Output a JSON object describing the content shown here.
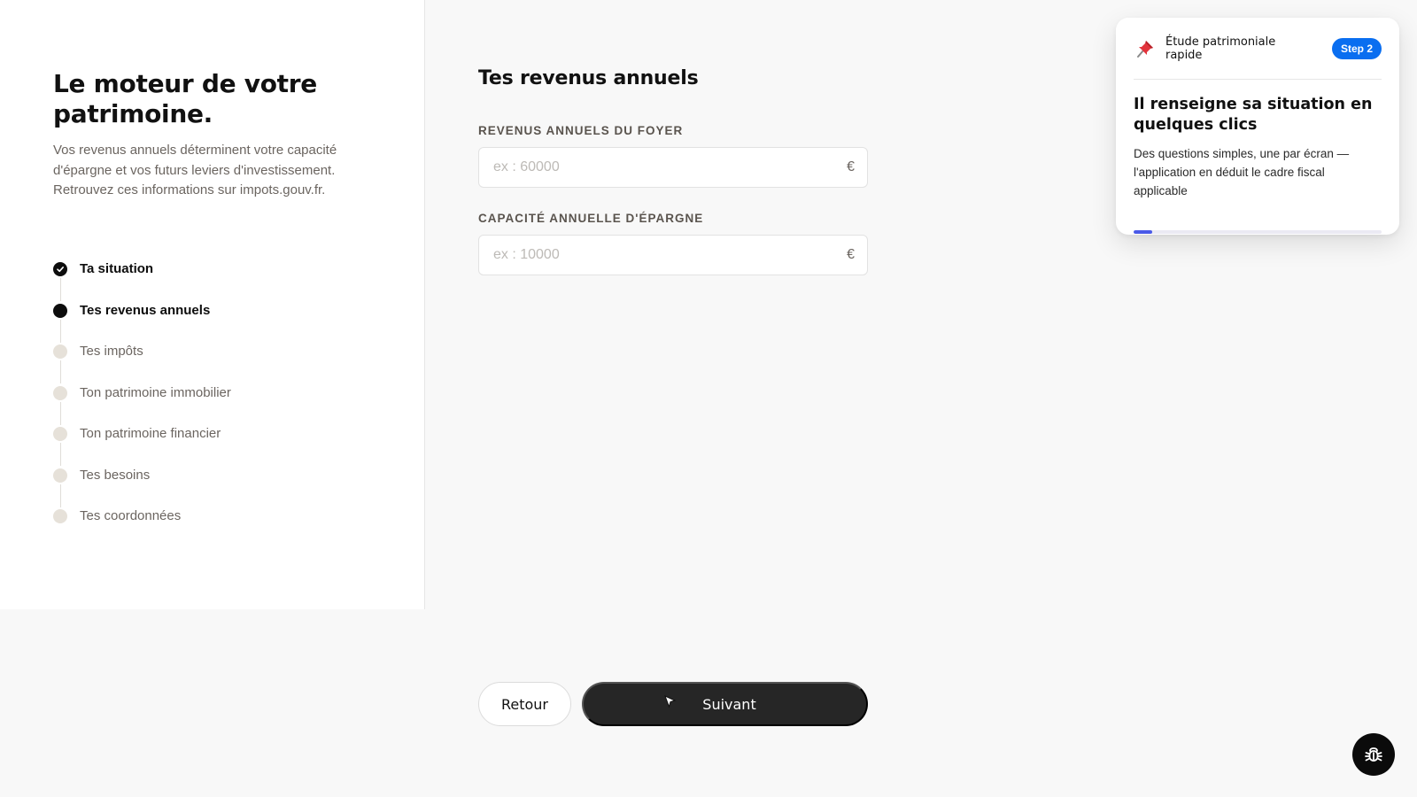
{
  "left": {
    "title": "Le moteur de votre patrimoine.",
    "description": "Vos revenus annuels déterminent votre capacité d'épargne et vos futurs leviers d'investissement. Retrouvez ces informations sur impots.gouv.fr.",
    "steps": [
      {
        "label": "Ta situation",
        "state": "done"
      },
      {
        "label": "Tes revenus annuels",
        "state": "active"
      },
      {
        "label": "Tes impôts",
        "state": "pending"
      },
      {
        "label": "Ton patrimoine immobilier",
        "state": "pending"
      },
      {
        "label": "Ton patrimoine financier",
        "state": "pending"
      },
      {
        "label": "Tes besoins",
        "state": "pending"
      },
      {
        "label": "Tes coordonnées",
        "state": "pending"
      }
    ]
  },
  "form": {
    "title": "Tes revenus annuels",
    "fields": [
      {
        "label": "REVENUS ANNUELS DU FOYER",
        "placeholder": "ex : 60000",
        "value": "",
        "currency": "€"
      },
      {
        "label": "CAPACITÉ ANNUELLE D'ÉPARGNE",
        "placeholder": "ex : 10000",
        "value": "",
        "currency": "€"
      }
    ]
  },
  "buttons": {
    "back": "Retour",
    "next": "Suivant"
  },
  "tour": {
    "header": "Étude patrimoniale rapide",
    "badge": "Step 2",
    "title": "Il renseigne sa situation en quelques clics",
    "body": "Des questions simples, une par écran — l'application en déduit le cadre fiscal applicable",
    "progress": 0.075,
    "icon": "pushpin-icon"
  },
  "colors": {
    "accent": "#0a6ef0",
    "progress": "#4a5ae8",
    "dark": "#262626"
  },
  "icons": {
    "debug": "bug-icon",
    "cursor": "cursor-icon",
    "check": "check-icon"
  }
}
